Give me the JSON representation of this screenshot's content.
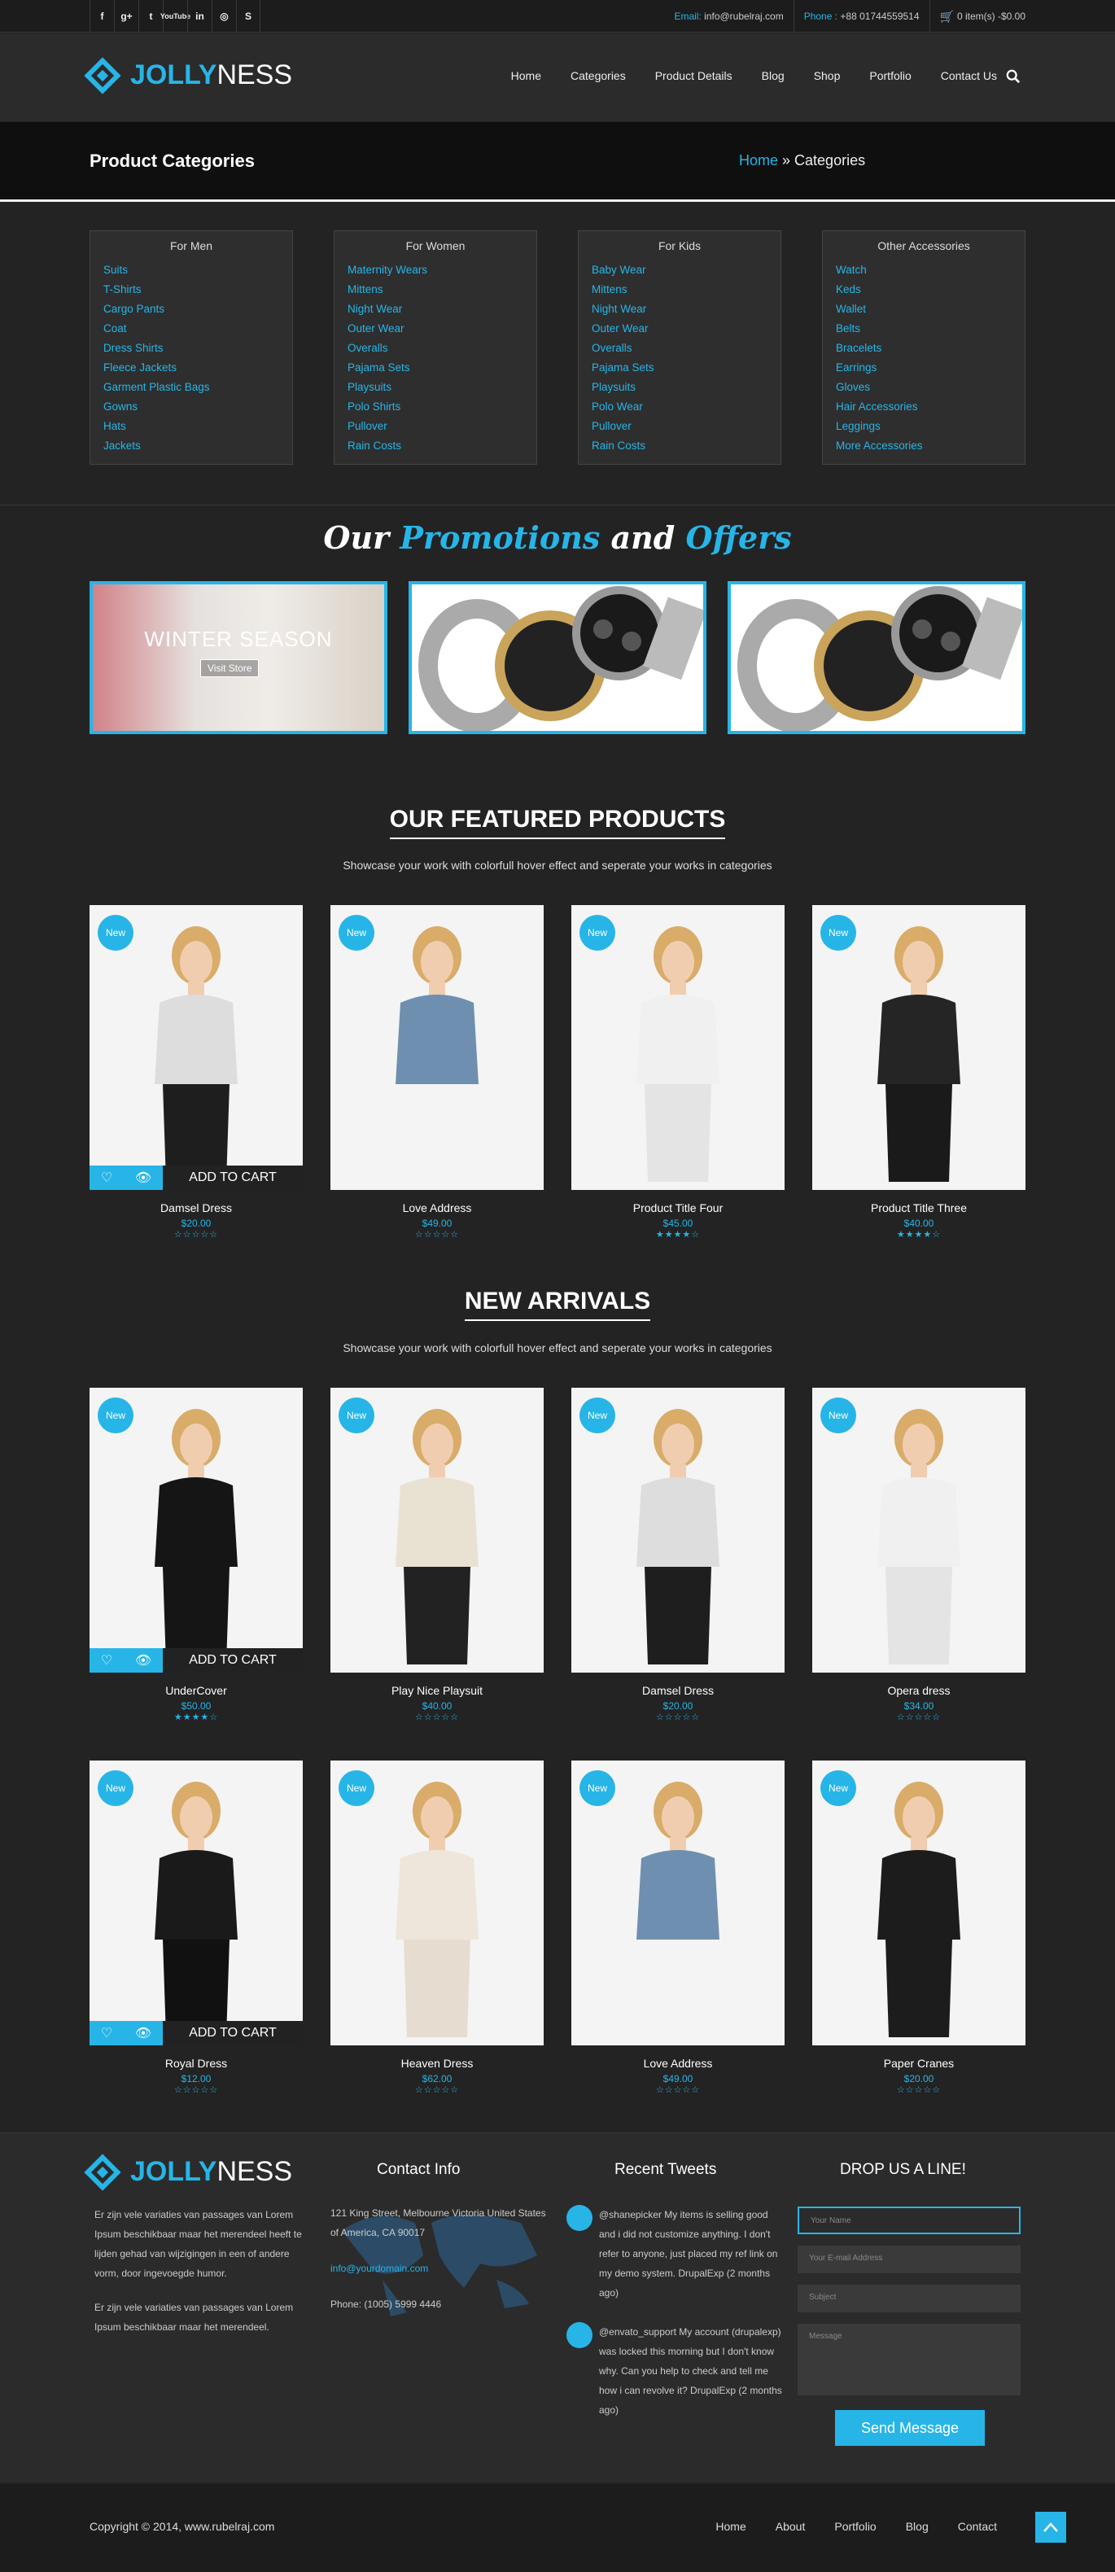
{
  "topbar": {
    "social": [
      "f",
      "g+",
      "t",
      "YouTube",
      "in",
      "◎",
      "S"
    ],
    "email_label": "Email:",
    "email": "info@rubelraj.com",
    "phone_label": "Phone :",
    "phone": "+88 01744559514",
    "cart": "0 item(s) -$0.00"
  },
  "header": {
    "logo_a": "JOLLY",
    "logo_b": "NESS",
    "nav": [
      "Home",
      "Categories",
      "Product Details",
      "Blog",
      "Shop",
      "Portfolio",
      "Contact Us"
    ]
  },
  "titleband": {
    "title": "Product Categories",
    "crumb_home": "Home",
    "crumb_sep": " » ",
    "crumb_current": "Categories"
  },
  "categories": [
    {
      "title": "For Men",
      "items": [
        "Suits",
        "T-Shirts",
        "Cargo Pants",
        "Coat",
        "Dress Shirts",
        "Fleece Jackets",
        "Garment Plastic Bags",
        "Gowns",
        "Hats",
        "Jackets"
      ]
    },
    {
      "title": "For Women",
      "items": [
        "Maternity Wears",
        "Mittens",
        "Night Wear",
        "Outer Wear",
        "Overalls",
        "Pajama Sets",
        "Playsuits",
        "Polo Shirts",
        "Pullover",
        "Rain Costs"
      ]
    },
    {
      "title": "For Kids",
      "items": [
        "Baby Wear",
        "Mittens",
        "Night Wear",
        "Outer Wear",
        "Overalls",
        "Pajama Sets",
        "Playsuits",
        "Polo Wear",
        "Pullover",
        "Rain Costs"
      ]
    },
    {
      "title": "Other Accessories",
      "items": [
        "Watch",
        "Keds",
        "Wallet",
        "Belts",
        "Bracelets",
        "Earrings",
        "Gloves",
        "Hair Accessories",
        "Leggings",
        "More Accessories"
      ]
    }
  ],
  "promotions": {
    "t1": "Our ",
    "t2": "Promotions",
    "t3": " and ",
    "t4": "Offers",
    "banner": "WINTER SEASON",
    "button": "Visit Store"
  },
  "featured": {
    "title": "OUR FEATURED PRODUCTS",
    "subtitle": "Showcase your work with colorfull hover effect and seperate your works in categories",
    "products": [
      {
        "name": "Damsel Dress",
        "price": "$20.00",
        "stars": "☆☆☆☆☆",
        "badge": "New",
        "top": "#ddd",
        "bottom": "#1e1e1e"
      },
      {
        "name": "Love Address",
        "price": "$49.00",
        "stars": "☆☆☆☆☆",
        "badge": "New",
        "top": "#6f8fb0",
        "bottom": "#f4f4f4"
      },
      {
        "name": "Product Title Four",
        "price": "$45.00",
        "stars": "★★★★☆",
        "badge": "New",
        "top": "#f0f0f0",
        "bottom": "#e4e4e4"
      },
      {
        "name": "Product Title Three",
        "price": "$40.00",
        "stars": "★★★★☆",
        "badge": "New",
        "top": "#252525",
        "bottom": "#1a1a1a"
      }
    ],
    "add_to_cart": "ADD TO CART"
  },
  "arrivals": {
    "title": "NEW ARRIVALS",
    "subtitle": "Showcase your work with colorfull hover effect and seperate your works in categories",
    "products": [
      {
        "name": "UnderCover",
        "price": "$50.00",
        "stars": "★★★★☆",
        "badge": "New",
        "top": "#151515",
        "bottom": "#151515"
      },
      {
        "name": "Play Nice Playsuit",
        "price": "$40.00",
        "stars": "☆☆☆☆☆",
        "badge": "New",
        "top": "#e9e2d3",
        "bottom": "#222"
      },
      {
        "name": "Damsel Dress",
        "price": "$20.00",
        "stars": "☆☆☆☆☆",
        "badge": "New",
        "top": "#ddd",
        "bottom": "#1e1e1e"
      },
      {
        "name": "Opera dress",
        "price": "$34.00",
        "stars": "☆☆☆☆☆",
        "badge": "New",
        "top": "#f0f0f0",
        "bottom": "#e4e4e4"
      },
      {
        "name": "Royal Dress",
        "price": "$12.00",
        "stars": "☆☆☆☆☆",
        "badge": "New",
        "top": "#1a1a1a",
        "bottom": "#111"
      },
      {
        "name": "Heaven Dress",
        "price": "$62.00",
        "stars": "☆☆☆☆☆",
        "badge": "New",
        "top": "#eee6da",
        "bottom": "#e6ddd0"
      },
      {
        "name": "Love Address",
        "price": "$49.00",
        "stars": "☆☆☆☆☆",
        "badge": "New",
        "top": "#6f8fb0",
        "bottom": "#f4f4f4"
      },
      {
        "name": "Paper Cranes",
        "price": "$20.00",
        "stars": "☆☆☆☆☆",
        "badge": "New",
        "top": "#1c1c1c",
        "bottom": "#1c1c1c"
      }
    ],
    "add_to_cart": "ADD TO CART"
  },
  "footer": {
    "about_1": "Er zijn vele variaties van passages van Lorem Ipsum beschikbaar maar het merendeel heeft te lijden gehad van wijzigingen in een of andere vorm, door ingevoegde humor.",
    "about_2": "Er zijn vele variaties van passages van Lorem Ipsum beschikbaar maar het merendeel.",
    "contact_head": "Contact Info",
    "address": "121 King Street, Melbourne Victoria United States of America, CA 90017",
    "email": "info@yourdomain.com",
    "phone": "Phone: (1005) 5999 4446",
    "tweets_head": "Recent Tweets",
    "tweet1": "@shanepicker My items is selling good and i did not customize anything. I don't refer to anyone, just placed my ref link on my demo system. DrupalExp (2 months ago)",
    "tweet2": "@envato_support My account (drupalexp) was locked this morning but I don't know why. Can you help to check and tell me how i can revolve it? DrupalExp (2 months ago)",
    "form_head": "DROP US A LINE!",
    "ph_name": "Your Name",
    "ph_email": "Your E-mail Address",
    "ph_subject": "Subject",
    "ph_message": "Message",
    "send": "Send Message"
  },
  "bottom": {
    "copyright": "Copyright © 2014, www.rubelraj.com",
    "nav": [
      "Home",
      "About",
      "Portfolio",
      "Blog",
      "Contact"
    ]
  }
}
